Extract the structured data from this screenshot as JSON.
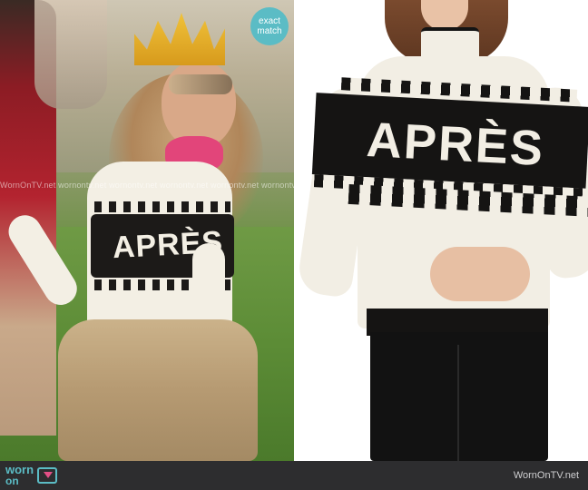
{
  "left_photo": {
    "sweater_text": "APRÈS",
    "watermark": "WornOnTV.net  wornontv.net  wornontv.net  wornontv.net  wornontv.net  wornontv.net  wornontv.net"
  },
  "right_photo": {
    "sweater_text": "APRÈS",
    "badge_line1": "exact",
    "badge_line2": "match"
  },
  "footer": {
    "logo_worn": "worn",
    "logo_on": "on",
    "site": "WornOnTV.net"
  },
  "colors": {
    "accent": "#5bbcc5",
    "footer_bg": "#2d2d2f",
    "sweater_black": "#151413",
    "sweater_cream": "#f2eee4"
  },
  "icons": {
    "badge": "exact-match-badge",
    "tv": "tv-icon"
  }
}
